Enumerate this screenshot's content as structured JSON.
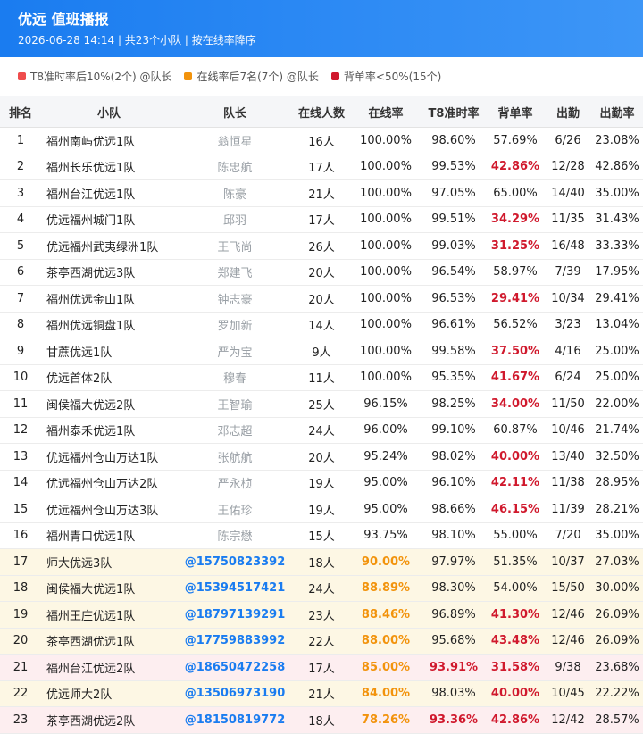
{
  "header": {
    "title": "优远 值班播报",
    "subtitle": "2026-06-28 14:14 | 共23个小队 | 按在线率降序"
  },
  "legend": [
    {
      "label": "T8准时率后10%(2个) @队长",
      "color": "#ef4c4c"
    },
    {
      "label": "在线率后7名(7个) @队长",
      "color": "#f2930c"
    },
    {
      "label": "背单率<50%(15个)",
      "color": "#d0192d"
    }
  ],
  "colors": {
    "red": "#d0192d",
    "orange": "#f2930c",
    "blue": "#1a7cf0",
    "yellow_band": "#fdf7e4",
    "pink_band": "#fdeef0"
  },
  "columns": [
    "排名",
    "小队",
    "队长",
    "在线人数",
    "在线率",
    "T8准时率",
    "背单率",
    "出勤",
    "出勤率"
  ],
  "rows": [
    {
      "rank": "1",
      "team": "福州南屿优远1队",
      "leader": "翁恒星",
      "online": "16人",
      "online_rate": "100.00%",
      "t8": "98.60%",
      "back": "57.69%",
      "att": "6/26",
      "att_rate": "23.08%"
    },
    {
      "rank": "2",
      "team": "福州长乐优远1队",
      "leader": "陈忠航",
      "online": "17人",
      "online_rate": "100.00%",
      "t8": "99.53%",
      "back": "42.86%",
      "att": "12/28",
      "att_rate": "42.86%",
      "back_red": true
    },
    {
      "rank": "3",
      "team": "福州台江优远1队",
      "leader": "陈豪",
      "online": "21人",
      "online_rate": "100.00%",
      "t8": "97.05%",
      "back": "65.00%",
      "att": "14/40",
      "att_rate": "35.00%"
    },
    {
      "rank": "4",
      "team": "优远福州城门1队",
      "leader": "邱羽",
      "online": "17人",
      "online_rate": "100.00%",
      "t8": "99.51%",
      "back": "34.29%",
      "att": "11/35",
      "att_rate": "31.43%",
      "back_red": true
    },
    {
      "rank": "5",
      "team": "优远福州武夷绿洲1队",
      "leader": "王飞尚",
      "online": "26人",
      "online_rate": "100.00%",
      "t8": "99.03%",
      "back": "31.25%",
      "att": "16/48",
      "att_rate": "33.33%",
      "back_red": true
    },
    {
      "rank": "6",
      "team": "茶亭西湖优远3队",
      "leader": "郑建飞",
      "online": "20人",
      "online_rate": "100.00%",
      "t8": "96.54%",
      "back": "58.97%",
      "att": "7/39",
      "att_rate": "17.95%"
    },
    {
      "rank": "7",
      "team": "福州优远金山1队",
      "leader": "钟志豪",
      "online": "20人",
      "online_rate": "100.00%",
      "t8": "96.53%",
      "back": "29.41%",
      "att": "10/34",
      "att_rate": "29.41%",
      "back_red": true
    },
    {
      "rank": "8",
      "team": "福州优远铜盘1队",
      "leader": "罗加新",
      "online": "14人",
      "online_rate": "100.00%",
      "t8": "96.61%",
      "back": "56.52%",
      "att": "3/23",
      "att_rate": "13.04%"
    },
    {
      "rank": "9",
      "team": "甘蔗优远1队",
      "leader": "严为宝",
      "online": "9人",
      "online_rate": "100.00%",
      "t8": "99.58%",
      "back": "37.50%",
      "att": "4/16",
      "att_rate": "25.00%",
      "back_red": true
    },
    {
      "rank": "10",
      "team": "优远首体2队",
      "leader": "穆春",
      "online": "11人",
      "online_rate": "100.00%",
      "t8": "95.35%",
      "back": "41.67%",
      "att": "6/24",
      "att_rate": "25.00%",
      "back_red": true
    },
    {
      "rank": "11",
      "team": "闽侯福大优远2队",
      "leader": "王智瑜",
      "online": "25人",
      "online_rate": "96.15%",
      "t8": "98.25%",
      "back": "34.00%",
      "att": "11/50",
      "att_rate": "22.00%",
      "back_red": true
    },
    {
      "rank": "12",
      "team": "福州泰禾优远1队",
      "leader": "邓志超",
      "online": "24人",
      "online_rate": "96.00%",
      "t8": "99.10%",
      "back": "60.87%",
      "att": "10/46",
      "att_rate": "21.74%"
    },
    {
      "rank": "13",
      "team": "优远福州仓山万达1队",
      "leader": "张航航",
      "online": "20人",
      "online_rate": "95.24%",
      "t8": "98.02%",
      "back": "40.00%",
      "att": "13/40",
      "att_rate": "32.50%",
      "back_red": true
    },
    {
      "rank": "14",
      "team": "优远福州仓山万达2队",
      "leader": "严永桢",
      "online": "19人",
      "online_rate": "95.00%",
      "t8": "96.10%",
      "back": "42.11%",
      "att": "11/38",
      "att_rate": "28.95%",
      "back_red": true
    },
    {
      "rank": "15",
      "team": "优远福州仓山万达3队",
      "leader": "王佑珍",
      "online": "19人",
      "online_rate": "95.00%",
      "t8": "98.66%",
      "back": "46.15%",
      "att": "11/39",
      "att_rate": "28.21%",
      "back_red": true
    },
    {
      "rank": "16",
      "team": "福州青口优远1队",
      "leader": "陈宗懋",
      "online": "15人",
      "online_rate": "93.75%",
      "t8": "98.10%",
      "back": "55.00%",
      "att": "7/20",
      "att_rate": "35.00%"
    },
    {
      "rank": "17",
      "team": "师大优远3队",
      "leader": "@15750823392",
      "online": "18人",
      "online_rate": "90.00%",
      "t8": "97.97%",
      "back": "51.35%",
      "att": "10/37",
      "att_rate": "27.03%",
      "band": "yellow",
      "mention": true,
      "rate_orange": true
    },
    {
      "rank": "18",
      "team": "闽侯福大优远1队",
      "leader": "@15394517421",
      "online": "24人",
      "online_rate": "88.89%",
      "t8": "98.30%",
      "back": "54.00%",
      "att": "15/50",
      "att_rate": "30.00%",
      "band": "yellow",
      "mention": true,
      "rate_orange": true
    },
    {
      "rank": "19",
      "team": "福州王庄优远1队",
      "leader": "@18797139291",
      "online": "23人",
      "online_rate": "88.46%",
      "t8": "96.89%",
      "back": "41.30%",
      "att": "12/46",
      "att_rate": "26.09%",
      "band": "yellow",
      "mention": true,
      "rate_orange": true,
      "back_red": true
    },
    {
      "rank": "20",
      "team": "茶亭西湖优远1队",
      "leader": "@17759883992",
      "online": "22人",
      "online_rate": "88.00%",
      "t8": "95.68%",
      "back": "43.48%",
      "att": "12/46",
      "att_rate": "26.09%",
      "band": "yellow",
      "mention": true,
      "rate_orange": true,
      "back_red": true
    },
    {
      "rank": "21",
      "team": "福州台江优远2队",
      "leader": "@18650472258",
      "online": "17人",
      "online_rate": "85.00%",
      "t8": "93.91%",
      "back": "31.58%",
      "att": "9/38",
      "att_rate": "23.68%",
      "band": "pink",
      "mention": true,
      "rate_orange": true,
      "t8_red": true,
      "back_red": true
    },
    {
      "rank": "22",
      "team": "优远师大2队",
      "leader": "@13506973190",
      "online": "21人",
      "online_rate": "84.00%",
      "t8": "98.03%",
      "back": "40.00%",
      "att": "10/45",
      "att_rate": "22.22%",
      "band": "yellow",
      "mention": true,
      "rate_orange": true,
      "back_red": true
    },
    {
      "rank": "23",
      "team": "茶亭西湖优远2队",
      "leader": "@18150819772",
      "online": "18人",
      "online_rate": "78.26%",
      "t8": "93.36%",
      "back": "42.86%",
      "att": "12/42",
      "att_rate": "28.57%",
      "band": "pink",
      "mention": true,
      "rate_orange": true,
      "t8_red": true,
      "back_red": true
    }
  ]
}
